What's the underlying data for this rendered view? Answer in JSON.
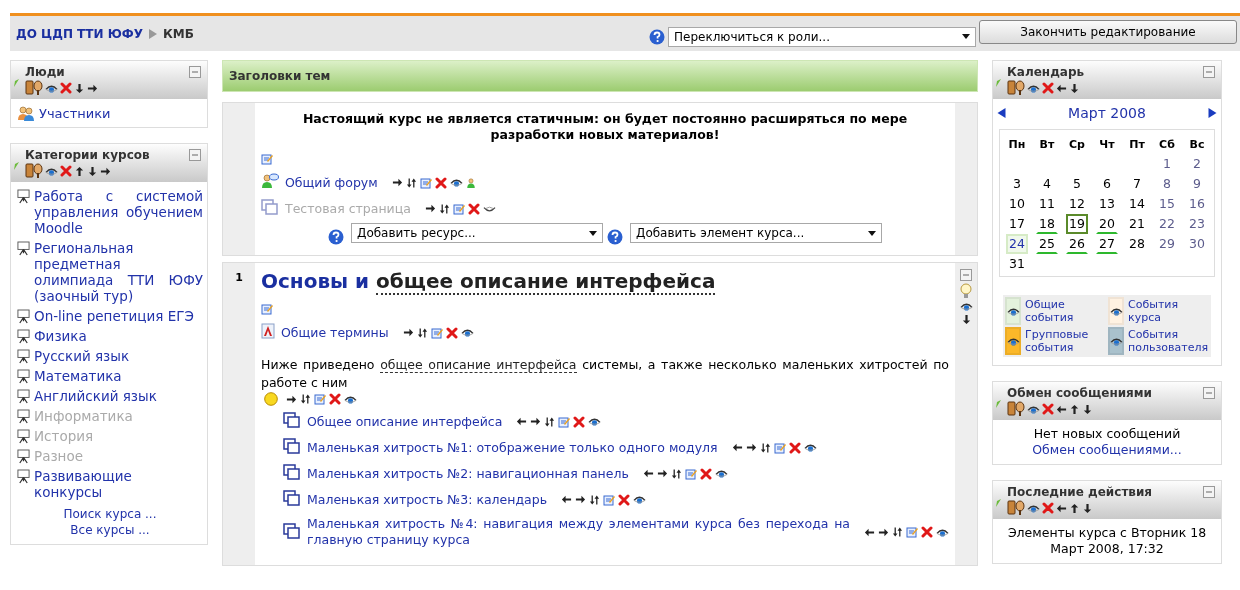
{
  "header": {
    "site": "ДО ЦДП ТТИ ЮФУ",
    "course": "КМБ",
    "role_select": "Переключиться к роли...",
    "finish_button": "Закончить редактирование"
  },
  "people": {
    "title": "Люди",
    "tools": [
      {
        "kind": "roles"
      },
      {
        "kind": "hide"
      },
      {
        "kind": "delete"
      },
      {
        "kind": "down"
      },
      {
        "kind": "right"
      }
    ],
    "link": "Участники"
  },
  "categories": {
    "title": "Категории курсов",
    "tools": [
      {
        "kind": "roles"
      },
      {
        "kind": "hide"
      },
      {
        "kind": "delete"
      },
      {
        "kind": "up"
      },
      {
        "kind": "down"
      },
      {
        "kind": "right"
      }
    ],
    "items": [
      {
        "text": "Работа с системой управления обучением Moodle",
        "hidden": false
      },
      {
        "text": "Региональная предметная олимпиада ТТИ ЮФУ (заочный тур)",
        "hidden": false
      },
      {
        "text": "On-line репетиция ЕГЭ",
        "hidden": false
      },
      {
        "text": "Физика",
        "hidden": false
      },
      {
        "text": "Русский язык",
        "hidden": false
      },
      {
        "text": "Математика",
        "hidden": false
      },
      {
        "text": "Английский язык",
        "hidden": false
      },
      {
        "text": "Информатика",
        "hidden": true
      },
      {
        "text": "История",
        "hidden": true
      },
      {
        "text": "Разное",
        "hidden": true
      },
      {
        "text": "Развивающие конкурсы",
        "hidden": false
      }
    ],
    "links": [
      "Поиск курса ...",
      "Все курсы ..."
    ]
  },
  "topics": {
    "title": "Заголовки тем",
    "sections": [
      {
        "summary": "Настоящий курс не является статичным: он будет постоянно расширяться по мере разработки новых материалов!",
        "items": [
          {
            "kind": "forum",
            "text": "Общий форум",
            "hidden": false,
            "indented": false,
            "tools": [
              {
                "kind": "right"
              },
              {
                "kind": "move"
              },
              {
                "kind": "edit"
              },
              {
                "kind": "delete"
              },
              {
                "kind": "hide"
              },
              {
                "kind": "group"
              }
            ]
          },
          {
            "kind": "page",
            "text": "Тестовая страница",
            "hidden": true,
            "indented": false,
            "tools": [
              {
                "kind": "right"
              },
              {
                "kind": "move"
              },
              {
                "kind": "edit"
              },
              {
                "kind": "delete"
              },
              {
                "kind": "show"
              }
            ]
          }
        ],
        "add_resource": "Добавить ресурс...",
        "add_activity": "Добавить элемент курса..."
      },
      {
        "number": "1",
        "title": "Основы и",
        "title_link": "общее описание интерфейса",
        "items": [
          {
            "kind": "glossary",
            "text": "Общие термины",
            "hidden": false,
            "indented": false,
            "tools": [
              {
                "kind": "right"
              },
              {
                "kind": "move"
              },
              {
                "kind": "edit"
              },
              {
                "kind": "delete"
              },
              {
                "kind": "hide"
              }
            ]
          },
          {
            "kind": "label",
            "text_before": "Ниже приведено ",
            "link": "общее описание интерфейса",
            "text_after": " системы, а также несколько маленьких хитростей по работе с ним",
            "tools": [
              {
                "kind": "right"
              },
              {
                "kind": "move"
              },
              {
                "kind": "edit"
              },
              {
                "kind": "delete"
              },
              {
                "kind": "hide"
              }
            ]
          },
          {
            "kind": "page",
            "text": "Общее описание интерфейса",
            "hidden": false,
            "indented": true,
            "tools": [
              {
                "kind": "left"
              },
              {
                "kind": "right"
              },
              {
                "kind": "move"
              },
              {
                "kind": "edit"
              },
              {
                "kind": "delete"
              },
              {
                "kind": "hide"
              }
            ]
          },
          {
            "kind": "page",
            "text": "Маленькая хитрость №1: отображение только одного модуля",
            "hidden": false,
            "indented": true,
            "tools": [
              {
                "kind": "left"
              },
              {
                "kind": "right"
              },
              {
                "kind": "move"
              },
              {
                "kind": "edit"
              },
              {
                "kind": "delete"
              },
              {
                "kind": "hide"
              }
            ]
          },
          {
            "kind": "page",
            "text": "Маленькая хитрость №2: навигационная панель",
            "hidden": false,
            "indented": true,
            "tools": [
              {
                "kind": "left"
              },
              {
                "kind": "right"
              },
              {
                "kind": "move"
              },
              {
                "kind": "edit"
              },
              {
                "kind": "delete"
              },
              {
                "kind": "hide"
              }
            ]
          },
          {
            "kind": "page",
            "text": "Маленькая хитрость №3: календарь",
            "hidden": false,
            "indented": true,
            "tools": [
              {
                "kind": "left"
              },
              {
                "kind": "right"
              },
              {
                "kind": "move"
              },
              {
                "kind": "edit"
              },
              {
                "kind": "delete"
              },
              {
                "kind": "hide"
              }
            ]
          },
          {
            "kind": "page",
            "text": "Маленькая хитрость №4: навигация между элементами курса без перехода на главную страницу курса",
            "hidden": false,
            "indented": true,
            "tools": [
              {
                "kind": "left"
              },
              {
                "kind": "right"
              },
              {
                "kind": "move"
              },
              {
                "kind": "edit"
              },
              {
                "kind": "delete"
              },
              {
                "kind": "hide"
              }
            ]
          }
        ]
      }
    ]
  },
  "calendar": {
    "title": "Календарь",
    "tools": [
      {
        "kind": "roles"
      },
      {
        "kind": "hide"
      },
      {
        "kind": "delete"
      },
      {
        "kind": "left"
      },
      {
        "kind": "down"
      }
    ],
    "month": "Март 2008",
    "weekdays": [
      "Пн",
      "Вт",
      "Ср",
      "Чт",
      "Пт",
      "Сб",
      "Вс"
    ],
    "weeks": [
      [
        {
          "kind": "blank"
        },
        {
          "kind": "blank"
        },
        {
          "kind": "blank"
        },
        {
          "kind": "blank"
        },
        {
          "kind": "blank"
        },
        {
          "kind": "day",
          "day": "1",
          "weekend": true,
          "today": false,
          "event": false,
          "global": false
        },
        {
          "kind": "day",
          "day": "2",
          "weekend": true,
          "today": false,
          "event": false,
          "global": false
        }
      ],
      [
        {
          "kind": "day",
          "day": "3",
          "weekend": false,
          "today": false,
          "event": false,
          "global": false
        },
        {
          "kind": "day",
          "day": "4",
          "weekend": false,
          "today": false,
          "event": false,
          "global": false
        },
        {
          "kind": "day",
          "day": "5",
          "weekend": false,
          "today": false,
          "event": false,
          "global": false
        },
        {
          "kind": "day",
          "day": "6",
          "weekend": false,
          "today": false,
          "event": false,
          "global": false
        },
        {
          "kind": "day",
          "day": "7",
          "weekend": false,
          "today": false,
          "event": false,
          "global": false
        },
        {
          "kind": "day",
          "day": "8",
          "weekend": true,
          "today": false,
          "event": false,
          "global": false
        },
        {
          "kind": "day",
          "day": "9",
          "weekend": true,
          "today": false,
          "event": false,
          "global": false
        }
      ],
      [
        {
          "kind": "day",
          "day": "10",
          "weekend": false,
          "today": false,
          "event": false,
          "global": false
        },
        {
          "kind": "day",
          "day": "11",
          "weekend": false,
          "today": false,
          "event": false,
          "global": false
        },
        {
          "kind": "day",
          "day": "12",
          "weekend": false,
          "today": false,
          "event": false,
          "global": false
        },
        {
          "kind": "day",
          "day": "13",
          "weekend": false,
          "today": false,
          "event": false,
          "global": false
        },
        {
          "kind": "day",
          "day": "14",
          "weekend": false,
          "today": false,
          "event": false,
          "global": false
        },
        {
          "kind": "day",
          "day": "15",
          "weekend": true,
          "today": false,
          "event": false,
          "global": false
        },
        {
          "kind": "day",
          "day": "16",
          "weekend": true,
          "today": false,
          "event": false,
          "global": false
        }
      ],
      [
        {
          "kind": "day",
          "day": "17",
          "weekend": false,
          "today": false,
          "event": false,
          "global": false
        },
        {
          "kind": "day",
          "day": "18",
          "weekend": false,
          "today": false,
          "event": true,
          "global": false
        },
        {
          "kind": "day",
          "day": "19",
          "weekend": false,
          "today": true,
          "event": true,
          "global": false
        },
        {
          "kind": "day",
          "day": "20",
          "weekend": false,
          "today": false,
          "event": true,
          "global": false
        },
        {
          "kind": "day",
          "day": "21",
          "weekend": false,
          "today": false,
          "event": false,
          "global": false
        },
        {
          "kind": "day",
          "day": "22",
          "weekend": true,
          "today": false,
          "event": false,
          "global": false
        },
        {
          "kind": "day",
          "day": "23",
          "weekend": true,
          "today": false,
          "event": false,
          "global": false
        }
      ],
      [
        {
          "kind": "day",
          "day": "24",
          "weekend": false,
          "today": false,
          "event": false,
          "global": true
        },
        {
          "kind": "day",
          "day": "25",
          "weekend": false,
          "today": false,
          "event": true,
          "global": false
        },
        {
          "kind": "day",
          "day": "26",
          "weekend": false,
          "today": false,
          "event": true,
          "global": false
        },
        {
          "kind": "day",
          "day": "27",
          "weekend": false,
          "today": false,
          "event": true,
          "global": false
        },
        {
          "kind": "day",
          "day": "28",
          "weekend": false,
          "today": false,
          "event": false,
          "global": false
        },
        {
          "kind": "day",
          "day": "29",
          "weekend": true,
          "today": false,
          "event": false,
          "global": false
        },
        {
          "kind": "day",
          "day": "30",
          "weekend": true,
          "today": false,
          "event": false,
          "global": false
        }
      ],
      [
        {
          "kind": "day",
          "day": "31",
          "weekend": false,
          "today": false,
          "event": false,
          "global": false
        }
      ]
    ],
    "legend": [
      {
        "text": "Общие события",
        "color": "#e4f2dc"
      },
      {
        "text": "События курса",
        "color": "#fff2e2"
      },
      {
        "text": "Групповые события",
        "color": "#fbb829"
      },
      {
        "text": "События пользователя",
        "color": "#a9c1cc"
      }
    ]
  },
  "messages": {
    "title": "Обмен сообщениями",
    "tools": [
      {
        "kind": "roles"
      },
      {
        "kind": "hide"
      },
      {
        "kind": "delete"
      },
      {
        "kind": "left"
      },
      {
        "kind": "up"
      },
      {
        "kind": "down"
      }
    ],
    "text": "Нет новых сообщений",
    "link": "Обмен сообщениями..."
  },
  "recent": {
    "title": "Последние действия",
    "tools": [
      {
        "kind": "roles"
      },
      {
        "kind": "hide"
      },
      {
        "kind": "delete"
      },
      {
        "kind": "left"
      },
      {
        "kind": "up"
      },
      {
        "kind": "down"
      }
    ],
    "text": "Элементы курса с Вторник 18 Март 2008, 17:32"
  }
}
